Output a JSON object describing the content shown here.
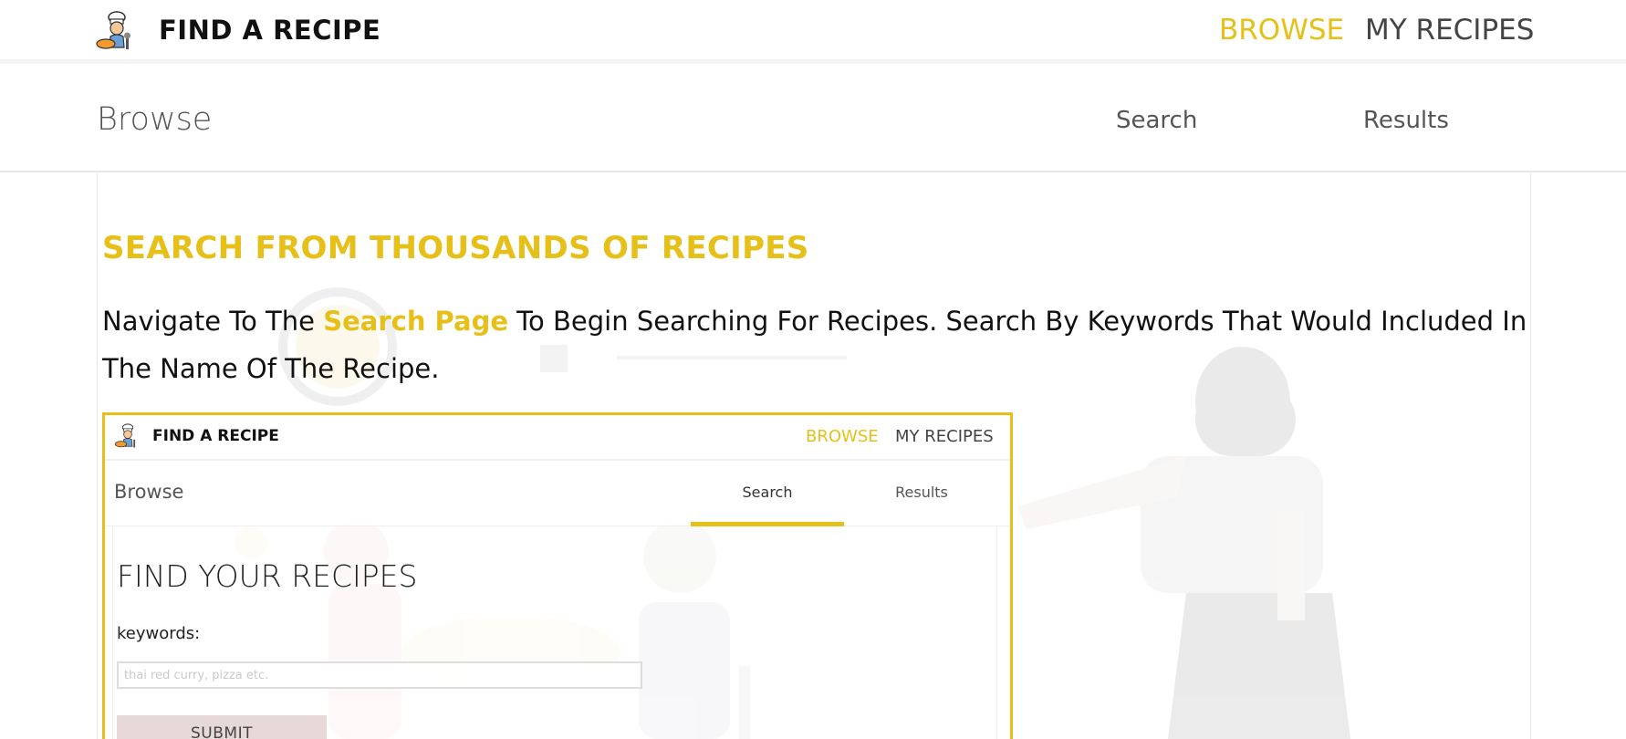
{
  "header": {
    "brand": "FIND A RECIPE",
    "nav": {
      "browse": "BROWSE",
      "my_recipes": "MY RECIPES"
    }
  },
  "subheader": {
    "title": "Browse",
    "tabs": {
      "search": "Search",
      "results": "Results"
    }
  },
  "main": {
    "heading": "SEARCH FROM THOUSANDS OF RECIPES",
    "paragraph": {
      "before": "Navigate To The ",
      "link": "Search Page",
      "after": " To Begin Searching For Recipes. Search By Keywords That Would Included In The Name Of The Recipe."
    }
  },
  "preview": {
    "brand": "FIND A RECIPE",
    "nav": {
      "browse": "BROWSE",
      "my_recipes": "MY RECIPES"
    },
    "subheader": {
      "title": "Browse",
      "search": "Search",
      "results": "Results"
    },
    "heading": "FIND YOUR RECIPES",
    "keywords_label": "keywords:",
    "input_placeholder": "thai red curry, pizza etc.",
    "submit_label": "SUBMIT"
  },
  "colors": {
    "accent": "#e6c019",
    "text": "#111111",
    "muted": "#555555",
    "submit_bg": "#e8d9d9"
  },
  "icons": [
    "chef-logo-icon"
  ]
}
